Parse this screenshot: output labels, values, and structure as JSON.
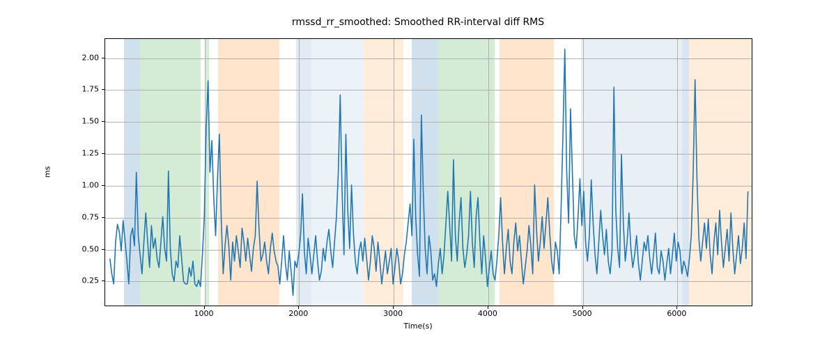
{
  "chart_data": {
    "type": "line",
    "title": "rmssd_rr_smoothed: Smoothed RR-interval diff RMS",
    "xlabel": "Time(s)",
    "ylabel": "ms",
    "xlim": [
      -50,
      6800
    ],
    "ylim": [
      0.05,
      2.15
    ],
    "xticks": [
      1000,
      2000,
      3000,
      4000,
      5000,
      6000
    ],
    "yticks": [
      0.25,
      0.5,
      0.75,
      1.0,
      1.25,
      1.5,
      1.75,
      2.0
    ],
    "ytick_labels": [
      "0.25",
      "0.50",
      "0.75",
      "1.00",
      "1.25",
      "1.50",
      "1.75",
      "2.00"
    ],
    "grid": true,
    "line_color": "#1f77b4",
    "bands": [
      {
        "x0": 150,
        "x1": 320,
        "color": "#6699c2",
        "alpha": 0.3
      },
      {
        "x0": 320,
        "x1": 960,
        "color": "#6fbf73",
        "alpha": 0.3
      },
      {
        "x0": 1010,
        "x1": 1050,
        "color": "#6fbf73",
        "alpha": 0.3
      },
      {
        "x0": 1140,
        "x1": 1790,
        "color": "#ff9933",
        "alpha": 0.25
      },
      {
        "x0": 1970,
        "x1": 2130,
        "color": "#6699c2",
        "alpha": 0.2
      },
      {
        "x0": 2130,
        "x1": 2680,
        "color": "#6699c2",
        "alpha": 0.12
      },
      {
        "x0": 2680,
        "x1": 3100,
        "color": "#ff9933",
        "alpha": 0.18
      },
      {
        "x0": 3190,
        "x1": 3470,
        "color": "#6699c2",
        "alpha": 0.3
      },
      {
        "x0": 3470,
        "x1": 4070,
        "color": "#6fbf73",
        "alpha": 0.3
      },
      {
        "x0": 4120,
        "x1": 4690,
        "color": "#ff9933",
        "alpha": 0.25
      },
      {
        "x0": 4980,
        "x1": 6050,
        "color": "#6699c2",
        "alpha": 0.15
      },
      {
        "x0": 6050,
        "x1": 6120,
        "color": "#6699c2",
        "alpha": 0.25
      },
      {
        "x0": 6120,
        "x1": 6800,
        "color": "#ff9933",
        "alpha": 0.18
      }
    ],
    "series": [
      {
        "name": "rmssd_rr_smoothed",
        "x": [
          0,
          20,
          40,
          60,
          80,
          100,
          120,
          140,
          160,
          180,
          200,
          220,
          240,
          260,
          280,
          300,
          320,
          340,
          360,
          380,
          400,
          420,
          440,
          460,
          480,
          500,
          520,
          540,
          560,
          580,
          600,
          620,
          640,
          660,
          680,
          700,
          720,
          740,
          760,
          780,
          800,
          820,
          840,
          860,
          880,
          900,
          920,
          940,
          960,
          980,
          1000,
          1020,
          1040,
          1060,
          1080,
          1100,
          1120,
          1140,
          1160,
          1180,
          1200,
          1220,
          1240,
          1260,
          1280,
          1300,
          1320,
          1340,
          1360,
          1380,
          1400,
          1420,
          1440,
          1460,
          1480,
          1500,
          1520,
          1540,
          1560,
          1580,
          1600,
          1620,
          1640,
          1660,
          1680,
          1700,
          1720,
          1740,
          1760,
          1780,
          1800,
          1820,
          1840,
          1860,
          1880,
          1900,
          1920,
          1940,
          1960,
          1980,
          2000,
          2020,
          2040,
          2060,
          2080,
          2100,
          2120,
          2140,
          2160,
          2180,
          2200,
          2220,
          2240,
          2260,
          2280,
          2300,
          2320,
          2340,
          2360,
          2380,
          2400,
          2420,
          2440,
          2460,
          2480,
          2500,
          2520,
          2540,
          2560,
          2580,
          2600,
          2620,
          2640,
          2660,
          2680,
          2700,
          2720,
          2740,
          2760,
          2780,
          2800,
          2820,
          2840,
          2860,
          2880,
          2900,
          2920,
          2940,
          2960,
          2980,
          3000,
          3020,
          3040,
          3060,
          3080,
          3100,
          3120,
          3140,
          3160,
          3180,
          3200,
          3220,
          3240,
          3260,
          3280,
          3300,
          3320,
          3340,
          3360,
          3380,
          3400,
          3420,
          3440,
          3460,
          3480,
          3500,
          3520,
          3540,
          3560,
          3580,
          3600,
          3620,
          3640,
          3660,
          3680,
          3700,
          3720,
          3740,
          3760,
          3780,
          3800,
          3820,
          3840,
          3860,
          3880,
          3900,
          3920,
          3940,
          3960,
          3980,
          4000,
          4020,
          4040,
          4060,
          4080,
          4100,
          4120,
          4140,
          4160,
          4180,
          4200,
          4220,
          4240,
          4260,
          4280,
          4300,
          4320,
          4340,
          4360,
          4380,
          4400,
          4420,
          4440,
          4460,
          4480,
          4500,
          4520,
          4540,
          4560,
          4580,
          4600,
          4620,
          4640,
          4660,
          4680,
          4700,
          4720,
          4740,
          4760,
          4780,
          4800,
          4820,
          4840,
          4860,
          4880,
          4900,
          4920,
          4940,
          4960,
          4980,
          5000,
          5020,
          5040,
          5060,
          5080,
          5100,
          5120,
          5140,
          5160,
          5180,
          5200,
          5220,
          5240,
          5260,
          5280,
          5300,
          5320,
          5340,
          5360,
          5380,
          5400,
          5420,
          5440,
          5460,
          5480,
          5500,
          5520,
          5540,
          5560,
          5580,
          5600,
          5620,
          5640,
          5660,
          5680,
          5700,
          5720,
          5740,
          5760,
          5780,
          5800,
          5820,
          5840,
          5860,
          5880,
          5900,
          5920,
          5940,
          5960,
          5980,
          6000,
          6020,
          6040,
          6060,
          6080,
          6100,
          6120,
          6140,
          6160,
          6180,
          6200,
          6220,
          6240,
          6260,
          6280,
          6300,
          6320,
          6340,
          6360,
          6380,
          6400,
          6420,
          6440,
          6460,
          6480,
          6500,
          6520,
          6540,
          6560,
          6580,
          6600,
          6620,
          6640,
          6660,
          6680,
          6700,
          6720,
          6740,
          6760,
          6780
        ],
        "y": [
          0.42,
          0.3,
          0.22,
          0.55,
          0.69,
          0.63,
          0.48,
          0.72,
          0.56,
          0.4,
          0.22,
          0.6,
          0.66,
          0.52,
          1.1,
          0.6,
          0.45,
          0.3,
          0.55,
          0.78,
          0.55,
          0.35,
          0.68,
          0.5,
          0.58,
          0.42,
          0.35,
          0.55,
          0.75,
          0.5,
          0.4,
          1.11,
          0.5,
          0.3,
          0.24,
          0.4,
          0.35,
          0.6,
          0.42,
          0.24,
          0.22,
          0.22,
          0.35,
          0.28,
          0.4,
          0.22,
          0.2,
          0.25,
          0.2,
          0.45,
          0.75,
          1.45,
          1.82,
          1.1,
          1.35,
          0.9,
          0.6,
          1.05,
          1.4,
          0.72,
          0.3,
          0.52,
          0.68,
          0.52,
          0.25,
          0.55,
          0.4,
          0.6,
          0.48,
          0.35,
          0.66,
          0.55,
          0.4,
          0.58,
          0.45,
          0.32,
          0.5,
          0.6,
          1.03,
          0.65,
          0.4,
          0.45,
          0.55,
          0.4,
          0.3,
          0.5,
          0.62,
          0.48,
          0.4,
          0.36,
          0.22,
          0.4,
          0.6,
          0.38,
          0.25,
          0.48,
          0.32,
          0.13,
          0.4,
          0.35,
          0.45,
          0.6,
          0.93,
          0.48,
          0.3,
          0.58,
          0.45,
          0.3,
          0.45,
          0.6,
          0.4,
          0.25,
          0.32,
          0.5,
          0.4,
          0.55,
          0.65,
          0.48,
          0.35,
          0.55,
          0.75,
          1.1,
          1.71,
          0.95,
          0.45,
          1.4,
          0.8,
          0.5,
          1.0,
          0.62,
          0.4,
          0.3,
          0.48,
          0.55,
          0.4,
          0.58,
          0.42,
          0.25,
          0.4,
          0.6,
          0.5,
          0.32,
          0.55,
          0.4,
          0.22,
          0.35,
          0.48,
          0.3,
          0.4,
          0.5,
          0.22,
          0.35,
          0.5,
          0.4,
          0.22,
          0.3,
          0.45,
          0.55,
          0.7,
          0.85,
          0.6,
          1.36,
          0.75,
          0.45,
          0.28,
          1.55,
          0.95,
          0.5,
          0.3,
          0.6,
          0.48,
          0.25,
          0.3,
          0.2,
          0.38,
          0.5,
          0.3,
          0.45,
          0.7,
          0.95,
          0.68,
          0.4,
          1.2,
          0.6,
          0.4,
          0.7,
          0.9,
          0.5,
          0.35,
          0.45,
          0.6,
          0.95,
          0.55,
          0.35,
          0.75,
          0.9,
          0.55,
          0.3,
          0.6,
          0.42,
          0.2,
          0.35,
          0.48,
          0.3,
          0.25,
          0.4,
          0.6,
          0.9,
          0.55,
          0.3,
          0.5,
          0.65,
          0.4,
          0.3,
          0.55,
          0.7,
          0.48,
          0.6,
          0.4,
          0.22,
          0.35,
          0.48,
          0.68,
          0.52,
          0.3,
          1.0,
          0.65,
          0.4,
          0.55,
          0.75,
          0.5,
          0.7,
          0.9,
          0.62,
          0.4,
          0.3,
          0.55,
          0.48,
          0.3,
          0.8,
          1.4,
          2.07,
          1.1,
          0.7,
          1.6,
          1.1,
          0.6,
          0.5,
          0.75,
          1.05,
          0.68,
          0.95,
          0.55,
          0.4,
          0.6,
          1.04,
          0.7,
          0.45,
          0.3,
          0.55,
          0.8,
          0.6,
          0.45,
          0.65,
          0.4,
          0.3,
          0.48,
          1.77,
          0.8,
          0.5,
          0.35,
          1.24,
          0.7,
          0.4,
          0.55,
          0.78,
          0.5,
          0.35,
          0.45,
          0.6,
          0.38,
          0.25,
          0.4,
          0.55,
          0.48,
          0.6,
          0.42,
          0.3,
          0.45,
          0.62,
          0.35,
          0.3,
          0.48,
          0.4,
          0.25,
          0.38,
          0.5,
          0.3,
          0.45,
          0.62,
          0.4,
          0.55,
          0.48,
          0.3,
          0.4,
          0.35,
          0.28,
          0.42,
          0.6,
          1.1,
          1.83,
          1.05,
          0.58,
          0.4,
          0.55,
          0.7,
          0.5,
          0.73,
          0.45,
          0.3,
          0.55,
          0.7,
          0.45,
          0.8,
          0.55,
          0.35,
          0.5,
          0.65,
          0.4,
          0.78,
          0.5,
          0.3,
          0.45,
          0.6,
          0.38,
          0.5,
          0.7,
          0.42,
          0.95
        ]
      }
    ]
  }
}
